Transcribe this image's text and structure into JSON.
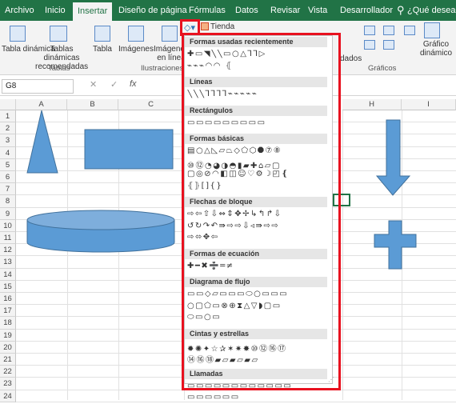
{
  "tabs": [
    "Archivo",
    "Inicio",
    "Insertar",
    "Diseño de página",
    "Fórmulas",
    "Datos",
    "Revisar",
    "Vista",
    "Desarrollador"
  ],
  "search_hint": "¿Qué desea hac",
  "search_icon": "lightbulb-icon",
  "ribbon": {
    "btn_pivot": "Tabla dinámica",
    "btn_rec_pivot": "Tablas dinámicas recomendadas",
    "btn_table": "Tabla",
    "btn_images": "Imágenes",
    "btn_online": "Imágenes en línea",
    "btn_store": "Tienda",
    "btn_ded": "dados",
    "btn_pivot_chart": "Gráfico dinámico",
    "grp_tablas": "Tablas",
    "grp_ilus": "Ilustraciones",
    "grp_graficos": "Gráficos"
  },
  "formula_bar": {
    "name_box": "G8",
    "cancel": "✕",
    "enter": "✓",
    "fx": "fx"
  },
  "columns": [
    "A",
    "B",
    "C",
    "H",
    "I"
  ],
  "rows": [
    "1",
    "2",
    "3",
    "4",
    "5",
    "6",
    "7",
    "8",
    "9",
    "10",
    "11",
    "12",
    "13",
    "14",
    "15",
    "16",
    "17",
    "18",
    "19",
    "20",
    "21",
    "22",
    "23",
    "24"
  ],
  "shapes_panel": {
    "sections": [
      {
        "label": "Formas usadas recientemente",
        "rows": [
          "✚▭◥╲╲▭○△⅂⅂▷",
          "⌁⌁⌁◠◠ ⦃"
        ]
      },
      {
        "label": "Líneas",
        "rows": [
          "╲╲╲⅂⅂⅂⅂⌁⌁⌁⌁⌁"
        ]
      },
      {
        "label": "Rectángulos",
        "rows": [
          "▭▭▭▭▭▭▭▭▭"
        ]
      },
      {
        "label": "Formas básicas",
        "rows": [
          "▤○△◺▱⏢◇⬠⬡⯃⑦⑧",
          "⑩⑫◔◕◑◓▮▰✚⌂▱▢",
          "▢◎⊘◠◧◫☺♡⚙☽◰❴",
          "⦃⦄[]{}"
        ]
      },
      {
        "label": "Flechas de bloque",
        "rows": [
          "⇨⇦⇧⇩⇔⇕✥✢↳↰↱⇩",
          "↺↻↷↶⇛⇨⇨⇩◃⇛⇨⇨",
          "⇨⬄✥⇦"
        ]
      },
      {
        "label": "Formas de ecuación",
        "rows": [
          "✚━✖➗═≠"
        ]
      },
      {
        "label": "Diagrama de flujo",
        "rows": [
          "▭▭◇▱▭▭▭⬭○▭▭▭",
          "○▢⬠▭⊗⊕⧗△▽◗▢▭",
          "⬭▭○▭"
        ]
      },
      {
        "label": "Cintas y estrellas",
        "rows": [
          "✹✺✦☆✰✶✷✸⑩⑫⑯⑰",
          "⑭⑯⑱▰▱▰▱▰▱"
        ]
      },
      {
        "label": "Llamadas",
        "rows": [
          "▭▭▭▭▭▭▭▭▭▭▭▭",
          "▭▭▭▭▭▭"
        ]
      }
    ]
  },
  "colors": {
    "excel_green": "#217346",
    "shape_fill": "#5b9bd5",
    "shape_edge": "#41719c",
    "highlight": "#e8111f"
  }
}
